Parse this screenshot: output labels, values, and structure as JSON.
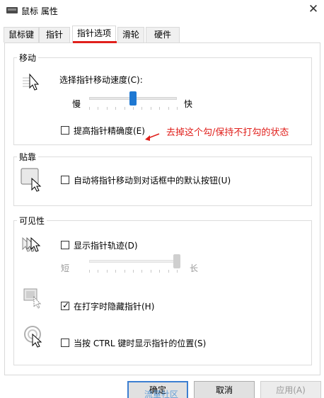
{
  "window": {
    "title": "鼠标 属性",
    "close_glyph": "✕"
  },
  "tabs": [
    {
      "label": "鼠标键"
    },
    {
      "label": "指针"
    },
    {
      "label": "指针选项"
    },
    {
      "label": "滑轮"
    },
    {
      "label": "硬件"
    }
  ],
  "active_tab": "指针选项",
  "motion": {
    "title": "移动",
    "speed_label": "选择指针移动速度(C):",
    "slow_label": "慢",
    "fast_label": "快",
    "speed_level_fraction": 0.5,
    "enhance_precision_label": "提高指针精确度(E)",
    "enhance_precision_checked": false
  },
  "annotation": {
    "text": "去掉这个勾/保持不打勾的状态",
    "color": "#e0201c"
  },
  "snap_to": {
    "title": "贴靠",
    "label": "自动将指针移动到对话框中的默认按钮(U)",
    "checked": false
  },
  "visibility": {
    "title": "可见性",
    "trails_label": "显示指针轨迹(D)",
    "trails_checked": false,
    "short_label": "短",
    "long_label": "长",
    "trails_level_fraction": 1.0,
    "hide_typing_label": "在打字时隐藏指针(H)",
    "hide_typing_checked": true,
    "ctrl_show_label": "当按 CTRL 键时显示指针的位置(S)",
    "ctrl_show_checked": false
  },
  "buttons": {
    "ok": "确定",
    "cancel": "取消",
    "apply": "应用(A)"
  },
  "watermark": "流量社区",
  "colors": {
    "accent": "#3c7fd1",
    "thumb_active": "#1e78d2",
    "annotation_red": "#e0201c"
  },
  "icons": [
    "mouse-icon",
    "pointer-speed-icon",
    "snap-to-icon",
    "pointer-trails-icon",
    "hide-pointer-icon",
    "pointer-locate-icon",
    "arrow-icon",
    "close-icon"
  ]
}
